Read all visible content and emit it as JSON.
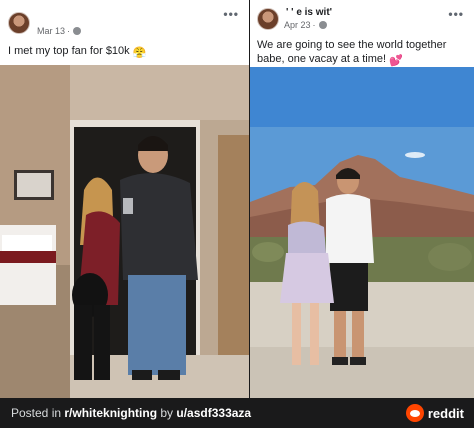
{
  "left_post": {
    "author": "",
    "date": "Mar 13",
    "separator": "·",
    "text": "I met my top fan for $10k",
    "emoji": "😤",
    "more": "•••"
  },
  "right_post": {
    "author": "'  ' e is wit'",
    "date": "Apr 23",
    "separator": "·",
    "text": "We are going to see the world together babe, one vacay at a time!",
    "emoji": "💕",
    "more": "•••"
  },
  "footer": {
    "prefix": "Posted in ",
    "subreddit": "r/whiteknighting",
    "by": " by ",
    "user": "u/asdf333aza",
    "brand": "reddit"
  },
  "colors": {
    "footer_bg": "#1a1a1b",
    "reddit_orange": "#ff4500",
    "meta_gray": "#65676b"
  }
}
